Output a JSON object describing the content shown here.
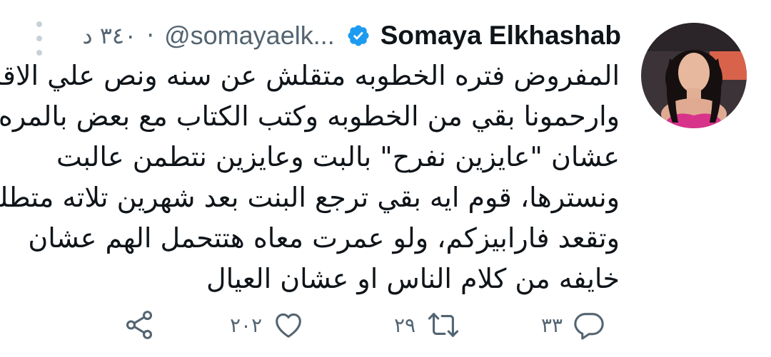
{
  "tweet": {
    "author_name": "Somaya Elkhashab",
    "handle": "@somayaelk...",
    "separator": "·",
    "time": "٣٤٠ د",
    "body_lines": [
      "المفروض فتره الخطوبه متقلش عن سنه ونص علي الاقل",
      "وارحمونا بقي من الخطوبه وكتب الكتاب مع بعض بالمره",
      "عشان \"عايزين نفرح\" بالبت وعايزين نتطمن عالبت",
      "ونسترها، قوم ايه بقي ترجع البنت بعد شهرين تلاته متطلقه",
      "وتقعد فارابيزكم، ولو عمرت معاه هتتحمل الهم عشان",
      "خايفه من كلام الناس او عشان العيال"
    ],
    "replies_count": "٣٣",
    "retweets_count": "٢٩",
    "likes_count": "٢٠٢"
  },
  "icons": {
    "verified": "verified-badge-icon",
    "more": "more-options-icon",
    "reply": "reply-icon",
    "retweet": "retweet-icon",
    "like": "like-icon",
    "share": "share-icon"
  },
  "colors": {
    "verified": "#1d9bf0",
    "secondary_text": "#536471",
    "primary_text": "#0f1419",
    "action_icon": "#536471"
  }
}
